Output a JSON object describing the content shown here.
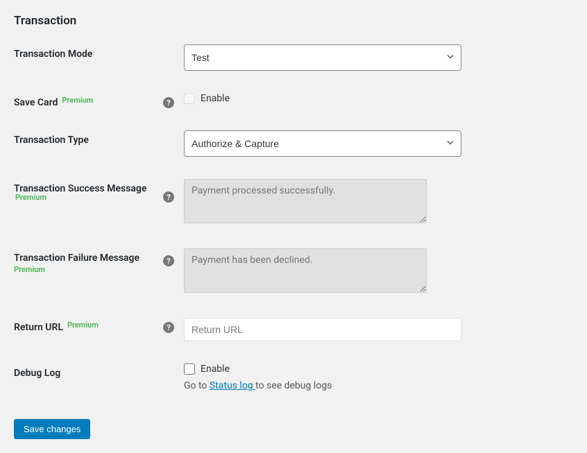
{
  "section": {
    "title": "Transaction"
  },
  "fields": {
    "transaction_mode": {
      "label": "Transaction Mode",
      "value": "Test"
    },
    "save_card": {
      "label": "Save Card",
      "premium": "Premium",
      "enable": "Enable"
    },
    "transaction_type": {
      "label": "Transaction Type",
      "value": "Authorize & Capture"
    },
    "success_message": {
      "label": "Transaction Success Message",
      "premium": "Premium",
      "value": "Payment processed successfully."
    },
    "failure_message": {
      "label": "Transaction Failure Message",
      "premium": "Premium",
      "value": "Payment has been declined."
    },
    "return_url": {
      "label": "Return URL",
      "premium": "Premium",
      "placeholder": "Return URL"
    },
    "debug_log": {
      "label": "Debug Log",
      "enable": "Enable",
      "help_prefix": "Go to ",
      "help_link": "Status log ",
      "help_suffix": "to see debug logs"
    }
  },
  "buttons": {
    "save": "Save changes"
  }
}
